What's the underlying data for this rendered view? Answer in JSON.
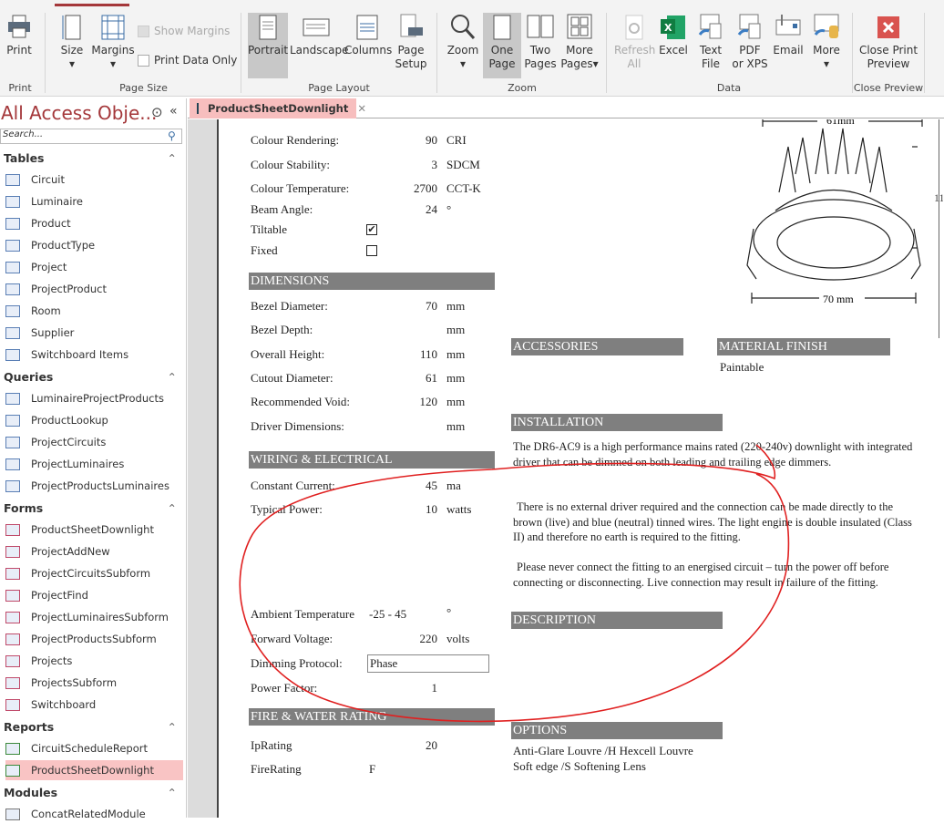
{
  "ribbon": {
    "buttons": {
      "print": "Print",
      "size": "Size",
      "margins": "Margins",
      "show_margins": "Show Margins",
      "print_data_only": "Print Data Only",
      "portrait": "Portrait",
      "landscape": "Landscape",
      "columns": "Columns",
      "page_setup_1": "Page",
      "page_setup_2": "Setup",
      "zoom": "Zoom",
      "one_page_1": "One",
      "one_page_2": "Page",
      "two_pages_1": "Two",
      "two_pages_2": "Pages",
      "more_pages_1": "More",
      "more_pages_2": "Pages",
      "refresh_1": "Refresh",
      "refresh_2": "All",
      "excel": "Excel",
      "text_file_1": "Text",
      "text_file_2": "File",
      "pdf_1": "PDF",
      "pdf_2": "or XPS",
      "email": "Email",
      "more": "More",
      "close_1": "Close Print",
      "close_2": "Preview"
    },
    "groups": {
      "print": "Print",
      "page_size": "Page Size",
      "page_layout": "Page Layout",
      "zoom": "Zoom",
      "data": "Data",
      "close_preview": "Close Preview"
    }
  },
  "nav": {
    "title": "All Access Obje...",
    "search_placeholder": "Search...",
    "sections": [
      {
        "label": "Tables",
        "items": [
          "Circuit",
          "Luminaire",
          "Product",
          "ProductType",
          "Project",
          "ProjectProduct",
          "Room",
          "Supplier",
          "Switchboard Items"
        ]
      },
      {
        "label": "Queries",
        "items": [
          "LuminaireProjectProducts",
          "ProductLookup",
          "ProjectCircuits",
          "ProjectLuminaires",
          "ProjectProductsLuminaires"
        ]
      },
      {
        "label": "Forms",
        "items": [
          "ProductSheetDownlight",
          "ProjectAddNew",
          "ProjectCircuitsSubform",
          "ProjectFind",
          "ProjectLuminairesSubform",
          "ProjectProductsSubform",
          "Projects",
          "ProjectsSubform",
          "Switchboard"
        ]
      },
      {
        "label": "Reports",
        "items": [
          "CircuitScheduleReport",
          "ProductSheetDownlight"
        ]
      },
      {
        "label": "Modules",
        "items": [
          "ConcatRelatedModule"
        ]
      }
    ],
    "selected": "Reports/ProductSheetDownlight"
  },
  "doc_tab": {
    "label": "ProductSheetDownlight"
  },
  "report": {
    "photometric": [
      {
        "label": "Colour Rendering:",
        "value": "90",
        "unit": "CRI"
      },
      {
        "label": "Colour Stability:",
        "value": "3",
        "unit": "SDCM"
      },
      {
        "label": "Colour Temperature:",
        "value": "2700",
        "unit": "CCT-K"
      },
      {
        "label": "Beam Angle:",
        "value": "24",
        "unit": "°"
      }
    ],
    "tiltable": {
      "label": "Tiltable",
      "checked": true
    },
    "fixed": {
      "label": "Fixed",
      "checked": false
    },
    "dimensions": {
      "header": "DIMENSIONS",
      "rows": [
        {
          "label": "Bezel Diameter:",
          "value": "70",
          "unit": "mm"
        },
        {
          "label": "Bezel Depth:",
          "value": "",
          "unit": "mm"
        },
        {
          "label": "Overall Height:",
          "value": "110",
          "unit": "mm"
        },
        {
          "label": "Cutout Diameter:",
          "value": "61",
          "unit": "mm"
        },
        {
          "label": "Recommended Void:",
          "value": "120",
          "unit": "mm"
        },
        {
          "label": "Driver Dimensions:",
          "value": "",
          "unit": "mm"
        }
      ]
    },
    "wiring": {
      "header": "WIRING & ELECTRICAL",
      "rows": [
        {
          "label": "Constant Current:",
          "value": "45",
          "unit": "ma"
        },
        {
          "label": "Typical Power:",
          "value": "10",
          "unit": "watts"
        }
      ],
      "ambient": {
        "label": "Ambient Temperature",
        "value": "-25 - 45",
        "unit": "°"
      },
      "forward": {
        "label": "Forward Voltage:",
        "value": "220",
        "unit": "volts"
      },
      "dimming": {
        "label": "Dimming Protocol:",
        "value": "Phase"
      },
      "power_factor": {
        "label": "Power Factor:",
        "value": "1"
      }
    },
    "fire": {
      "header": "FIRE & WATER RATING",
      "ip_label": "IpRating",
      "ip_value": "20",
      "fire_label": "FireRating",
      "fire_value": "F"
    },
    "drawing": {
      "top_dim": "61mm",
      "bottom_dim": "70 mm",
      "height_dim": "11"
    },
    "accessories": {
      "header": "ACCESSORIES"
    },
    "material": {
      "header": "MATERIAL FINISH",
      "value": "Paintable"
    },
    "installation": {
      "header": "INSTALLATION",
      "paragraphs": [
        "The DR6-AC9 is a high performance mains rated (220-240v) downlight with integrated driver that can be dimmed on both leading and trailing edge dimmers.",
        "There is no external driver required and the connection can be made directly to the brown (live) and blue (neutral) tinned wires. The light engine is double insulated (Class II) and therefore no earth is required to the fitting.",
        "Please never connect the fitting to an energised circuit – turn the power off before connecting or disconnecting.  Live connection may result in failure of the fitting."
      ]
    },
    "description": {
      "header": "DESCRIPTION"
    },
    "options": {
      "header": "OPTIONS",
      "lines": [
        "Anti-Glare Louvre /H Hexcell Louvre",
        "Soft edge /S Softening Lens"
      ]
    }
  },
  "annotation_color": "#e02020"
}
